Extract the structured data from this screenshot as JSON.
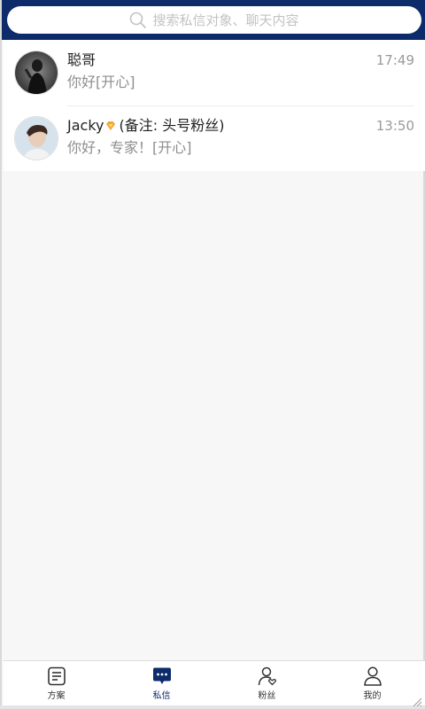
{
  "search": {
    "placeholder": "搜索私信对象、聊天内容"
  },
  "conversations": [
    {
      "name": "聪哥",
      "message": "你好[开心]",
      "time": "17:49",
      "remark": ""
    },
    {
      "name": "Jacky",
      "message": "你好，专家！[开心]",
      "time": "13:50",
      "remark": "(备注: 头号粉丝)"
    }
  ],
  "tabs": [
    {
      "label": "方案",
      "icon": "document-icon"
    },
    {
      "label": "私信",
      "icon": "chat-bubble-icon"
    },
    {
      "label": "粉丝",
      "icon": "user-heart-icon"
    },
    {
      "label": "我的",
      "icon": "user-icon"
    }
  ],
  "colors": {
    "header": "#0d2a6b",
    "accent": "#0d2a6b",
    "vip_badge": "#f0a830"
  }
}
